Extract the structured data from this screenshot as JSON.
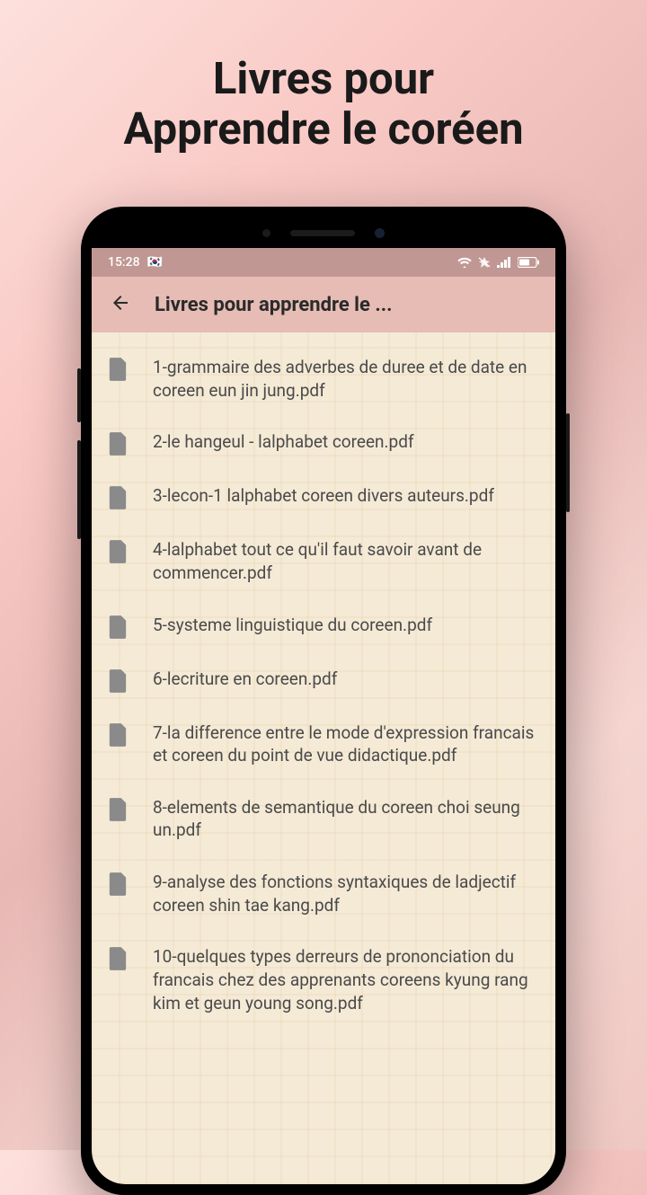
{
  "promo": {
    "line1": "Livres pour",
    "line2": "Apprendre le coréen"
  },
  "status_bar": {
    "time": "15:28",
    "app_indicator": "🇰🇷"
  },
  "app_bar": {
    "title": "Livres pour apprendre le ..."
  },
  "files": [
    {
      "name": "1-grammaire des adverbes de duree et de date en coreen eun jin jung.pdf"
    },
    {
      "name": "2-le hangeul - lalphabet coreen.pdf"
    },
    {
      "name": "3-lecon-1 lalphabet coreen divers auteurs.pdf"
    },
    {
      "name": "4-lalphabet tout ce qu'il faut savoir avant de commencer.pdf"
    },
    {
      "name": "5-systeme linguistique du coreen.pdf"
    },
    {
      "name": "6-lecriture en coreen.pdf"
    },
    {
      "name": "7-la difference entre le mode d'expression francais et coreen du point de vue didactique.pdf"
    },
    {
      "name": "8-elements de semantique du coreen choi seung un.pdf"
    },
    {
      "name": "9-analyse des fonctions syntaxiques de ladjectif coreen shin tae kang.pdf"
    },
    {
      "name": "10-quelques types derreurs de prononciation du francais chez des apprenants coreens kyung rang kim et geun young song.pdf"
    }
  ]
}
